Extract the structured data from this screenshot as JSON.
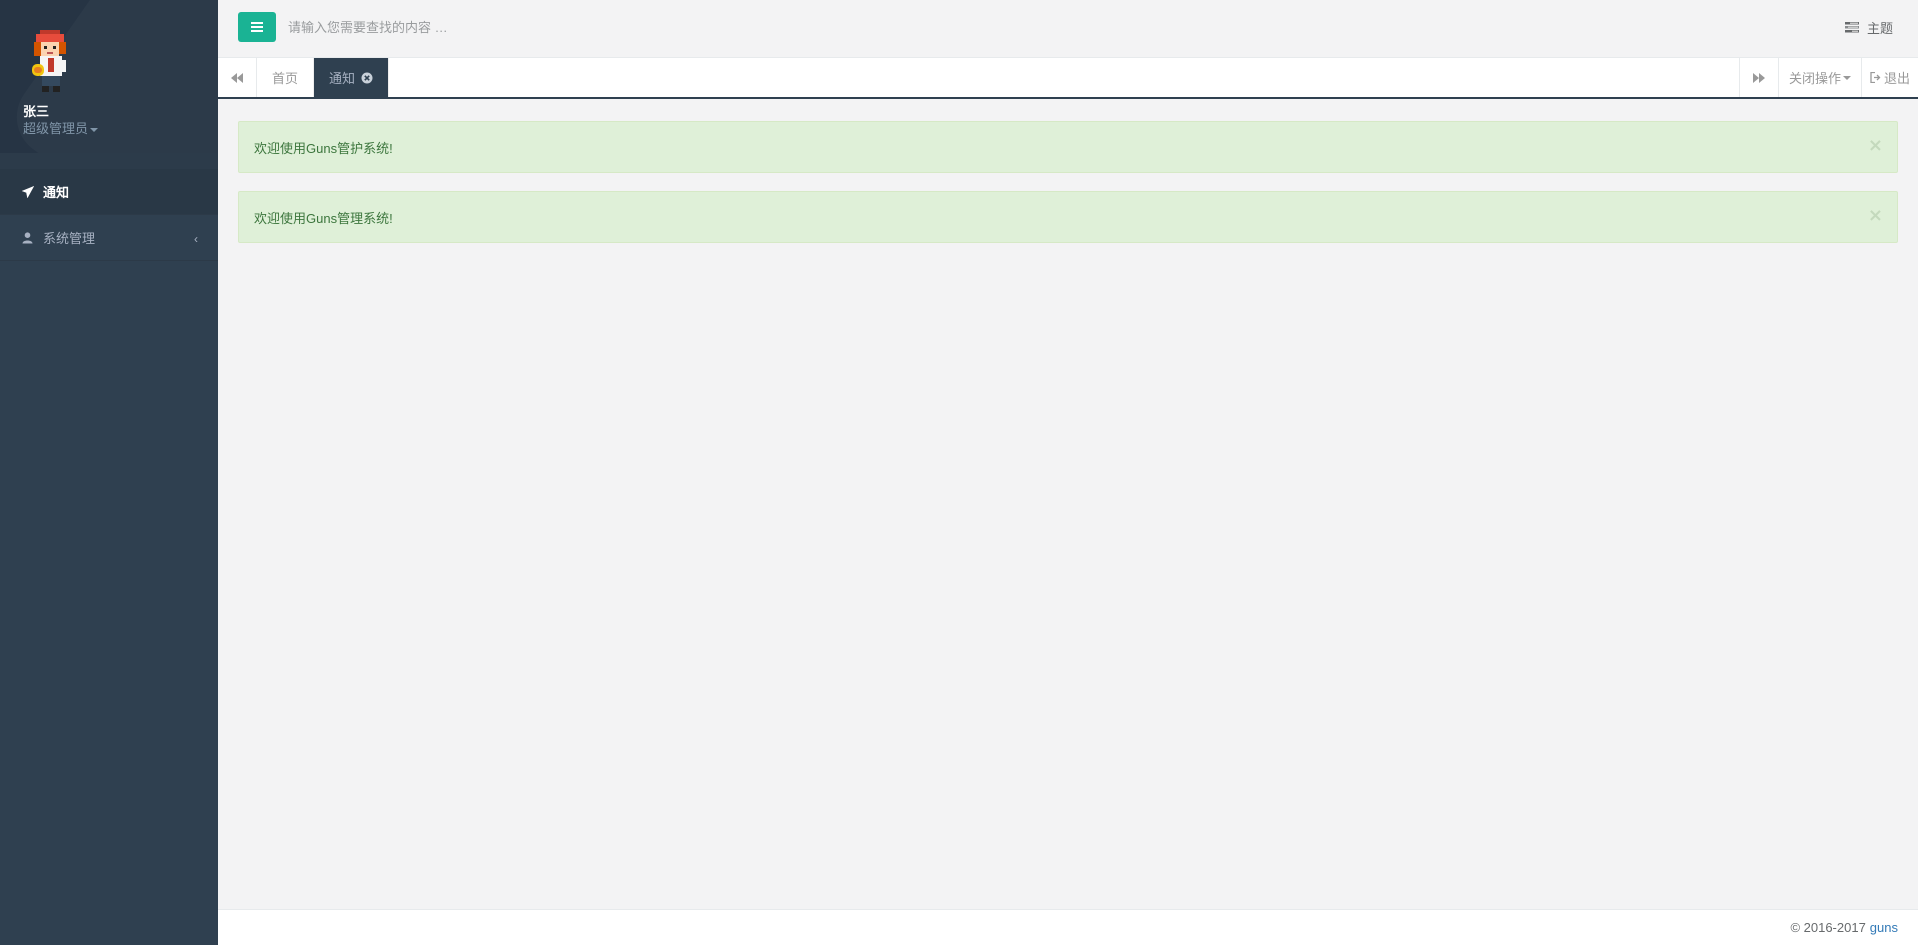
{
  "colors": {
    "sidebar_bg": "#2f4050",
    "accent": "#1ab394",
    "alert_bg": "#dff0d8",
    "alert_text": "#3c763d",
    "link": "#337ab7"
  },
  "sidebar": {
    "profile": {
      "name": "张三",
      "role": "超级管理员",
      "avatar_icon": "anime-character-avatar"
    },
    "items": [
      {
        "label": "通知",
        "icon": "rocket-icon",
        "active": true
      },
      {
        "label": "系统管理",
        "icon": "user-icon",
        "has_submenu": true,
        "arrow": "‹"
      }
    ]
  },
  "header": {
    "search": {
      "placeholder": "请输入您需要查找的内容 …",
      "value": ""
    },
    "theme_label": "主题"
  },
  "tabbar": {
    "tabs": [
      {
        "label": "首页",
        "active": false
      },
      {
        "label": "通知",
        "active": true,
        "closable": true
      }
    ],
    "close_ops_label": "关闭操作",
    "logout_label": "退出"
  },
  "alerts": [
    {
      "text": "欢迎使用Guns管护系统!",
      "close": "×"
    },
    {
      "text": "欢迎使用Guns管理系统!",
      "close": "×"
    }
  ],
  "footer": {
    "copyright": "© 2016-2017",
    "link_text": "guns"
  }
}
